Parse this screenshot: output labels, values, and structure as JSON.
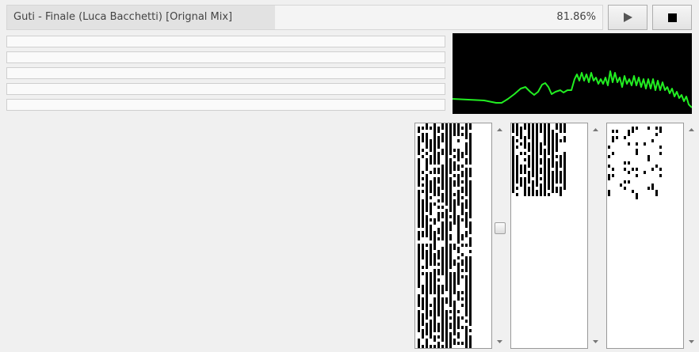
{
  "player": {
    "track_title": "Guti - Finale (Luca Bacchetti) [Orignal Mix]",
    "progress_text": "81.86%",
    "progress": 0.4503,
    "play_icon": "play-icon",
    "stop_icon": "stop-icon"
  },
  "meters": [
    {
      "level": 0
    },
    {
      "level": 0
    },
    {
      "level": 0
    },
    {
      "level": 0
    },
    {
      "level": 0
    }
  ],
  "spectrum": {
    "background": "#000000",
    "line_color": "#22ee22"
  },
  "panels": [
    {
      "columns": 18,
      "rows": 72
    },
    {
      "columns": 18,
      "rows": 72
    },
    {
      "columns": 18,
      "rows": 72
    }
  ],
  "scroll": {
    "up_icon": "scroll-up-arrow-icon",
    "down_icon": "scroll-down-arrow-icon",
    "thumb_positions": [
      0.45,
      0,
      0
    ]
  }
}
